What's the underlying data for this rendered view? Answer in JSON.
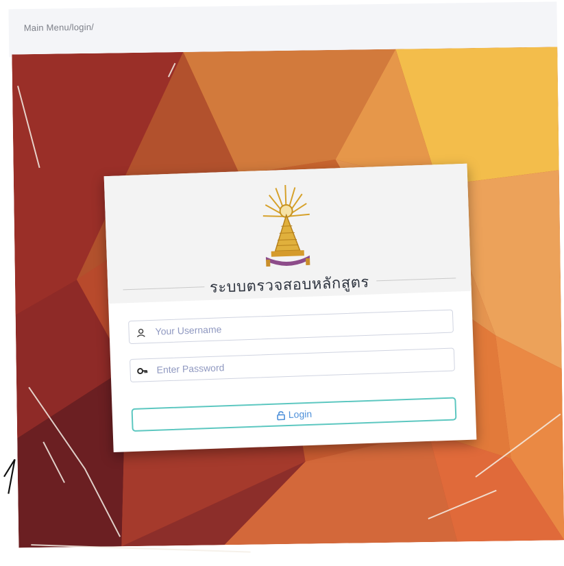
{
  "breadcrumb": "Main Menu/login/",
  "login_card": {
    "title": "ระบบตรวจสอบหลักสูตร",
    "username_placeholder": "Your Username",
    "password_placeholder": "Enter Password",
    "login_label": "Login"
  },
  "colors": {
    "login_border": "#5cc7c0",
    "login_text": "#4c8fd9",
    "placeholder": "#8f98c0"
  },
  "icons": [
    "user-icon",
    "key-icon",
    "lock-open-icon",
    "university-emblem"
  ]
}
